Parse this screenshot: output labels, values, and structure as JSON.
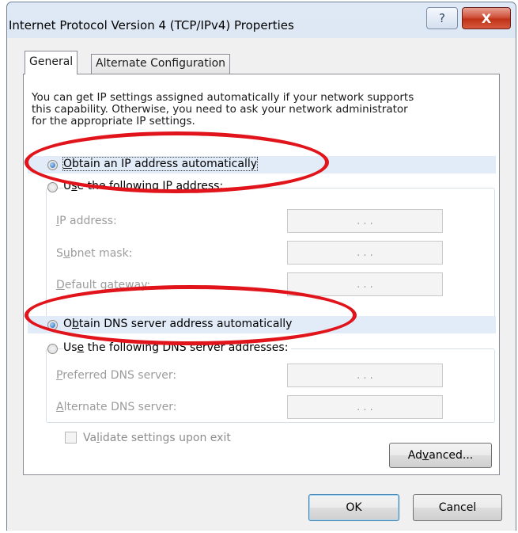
{
  "window": {
    "title": "Internet Protocol Version 4 (TCP/IPv4) Properties",
    "help_glyph": "?",
    "close_glyph": "X"
  },
  "tabs": [
    {
      "label": "General"
    },
    {
      "label": "Alternate Configuration"
    }
  ],
  "intro_text": "You can get IP settings assigned automatically if your network supports\nthis capability. Otherwise, you need to ask your network administrator\nfor the appropriate IP settings.",
  "ip": {
    "auto_pre": "",
    "auto_ul": "O",
    "auto_post": "btain an IP address automatically",
    "manual_pre": "U",
    "manual_ul": "s",
    "manual_post": "e the following IP address:",
    "fields": [
      {
        "pre": "",
        "ul": "I",
        "post": "P address:",
        "value": ". . ."
      },
      {
        "pre": "S",
        "ul": "u",
        "post": "bnet mask:",
        "value": ". . ."
      },
      {
        "pre": "",
        "ul": "D",
        "post": "efault gateway:",
        "value": ". . ."
      }
    ]
  },
  "dns": {
    "auto_pre": "O",
    "auto_ul": "b",
    "auto_post": "tain DNS server address automatically",
    "manual_pre": "Us",
    "manual_ul": "e",
    "manual_post": " the following DNS server addresses:",
    "fields": [
      {
        "pre": "",
        "ul": "P",
        "post": "referred DNS server:",
        "value": ". . ."
      },
      {
        "pre": "",
        "ul": "A",
        "post": "lternate DNS server:",
        "value": ". . ."
      }
    ]
  },
  "validate": {
    "pre": "Va",
    "ul": "l",
    "post": "idate settings upon exit",
    "checked": false
  },
  "buttons": {
    "advanced_pre": "Ad",
    "advanced_ul": "v",
    "advanced_post": "anced...",
    "ok": "OK",
    "cancel": "Cancel"
  },
  "selected": {
    "ip_mode": "automatic",
    "dns_mode": "automatic"
  },
  "colors": {
    "annotation": "#e0141a",
    "highlight": "#e1ecf8"
  }
}
